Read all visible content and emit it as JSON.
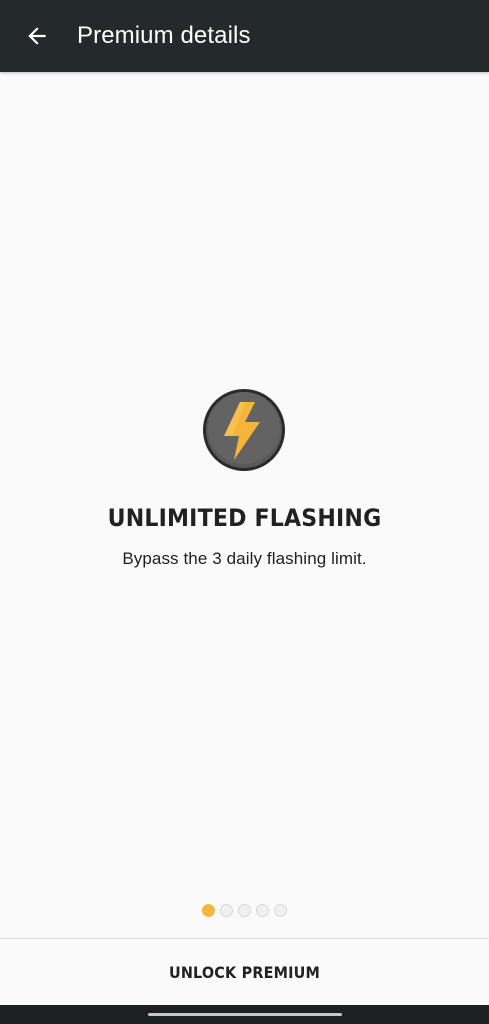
{
  "appbar": {
    "title": "Premium details",
    "back_icon": "arrow-left-icon",
    "background": "#242a2c"
  },
  "feature": {
    "icon": "lightning-bolt-icon",
    "title": "UNLIMITED FLASHING",
    "description": "Bypass the 3 daily flashing limit.",
    "accent": "#f3b73d"
  },
  "pager": {
    "total": 5,
    "active_index": 0
  },
  "footer": {
    "unlock_label": "UNLOCK PREMIUM"
  }
}
